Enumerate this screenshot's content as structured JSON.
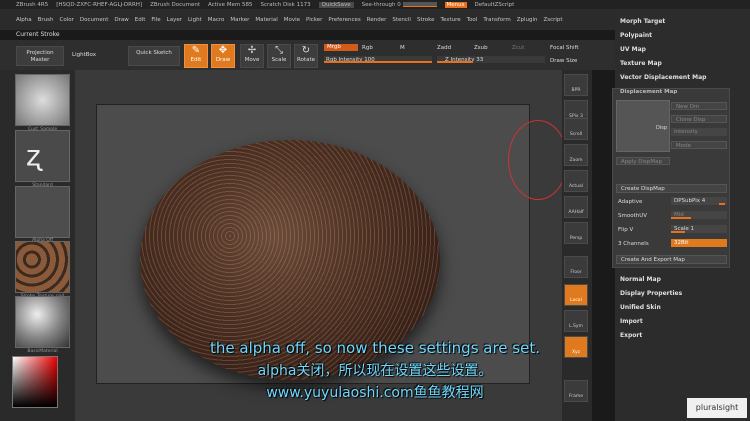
{
  "titlebar": {
    "app": "ZBrush 4R5",
    "doc_id": "[HSQD-ZXFC-RHEF-AGLJ-DRRH]",
    "document": "ZBrush Document",
    "active_mem": "Active Mem 585",
    "scratch": "Scratch Disk 1173",
    "quicksave": "QuickSave",
    "seethrough": "See-through",
    "seethrough_val": "0",
    "menus": "Menus",
    "script": "DefaultZScript"
  },
  "menubar": [
    "Alpha",
    "Brush",
    "Color",
    "Document",
    "Draw",
    "Edit",
    "File",
    "Layer",
    "Light",
    "Macro",
    "Marker",
    "Material",
    "Movie",
    "Picker",
    "Preferences",
    "Render",
    "Stencil",
    "Stroke",
    "Texture",
    "Tool",
    "Transform",
    "Zplugin",
    "Zscript"
  ],
  "current_stroke": "Current Stroke",
  "toolbar": {
    "projection_master": "Projection Master",
    "lightbox": "LightBox",
    "quick_sketch": "Quick Sketch",
    "edit": "Edit",
    "draw": "Draw",
    "move": "Move",
    "scale": "Scale",
    "rotate": "Rotate",
    "mrgb": "Mrgb",
    "rgb": "Rgb",
    "m": "M",
    "zadd": "Zadd",
    "zsub": "Zsub",
    "zcut": "Zcut",
    "focal_shift": "Focal Shift",
    "rgb_intensity": "Rgb Intensity 100",
    "z_intensity": "Z Intensity 33",
    "draw_size": "Draw Size"
  },
  "leftshelf": {
    "thumbs": [
      "Cust_Sample",
      "Standard",
      "Alpha Off",
      "Stroke_Texture_pad",
      "BasicMaterial"
    ]
  },
  "rightshelf": [
    "BPR",
    "SPix 3",
    "Scroll",
    "Zoom",
    "Actual",
    "AAHalf",
    "Persp",
    "Floor",
    "Local",
    "L.Sym",
    "Xyz",
    "Frame"
  ],
  "panel": {
    "morph_target": "Morph Target",
    "polypaint": "Polypaint",
    "uv_map": "UV Map",
    "texture_map": "Texture Map",
    "vector_displacement": "Vector Displacement Map",
    "displacement_map": "Displacement Map",
    "normal_map": "Normal Map",
    "display_properties": "Display Properties",
    "unified_skin": "Unified Skin",
    "import": "Import",
    "export": "Export"
  },
  "subpanel": {
    "thumb": "Disp",
    "new_dm": "New Dm",
    "clone_disp": "Clone Disp",
    "intensity": "Intensity",
    "mode": "Mode",
    "apply_dispmap": "Apply DispMap",
    "create_dispmap": "Create DispMap",
    "adaptive": "Adaptive",
    "dpsubpix": "DPSubPix 4",
    "smoothuv": "SmoothUV",
    "mid": "Mid",
    "flip_v": "Flip V",
    "scale": "Scale 1",
    "three_channels": "3 Channels",
    "bit32": "32Bit",
    "create_export": "Create And Export Map"
  },
  "subtitles": {
    "en": "the alpha off, so now these settings are set.",
    "zh": "alpha关闭，所以现在设置这些设置。",
    "url": "www.yuyulaoshi.com鱼鱼教程网"
  },
  "watermark": "pluralsight"
}
